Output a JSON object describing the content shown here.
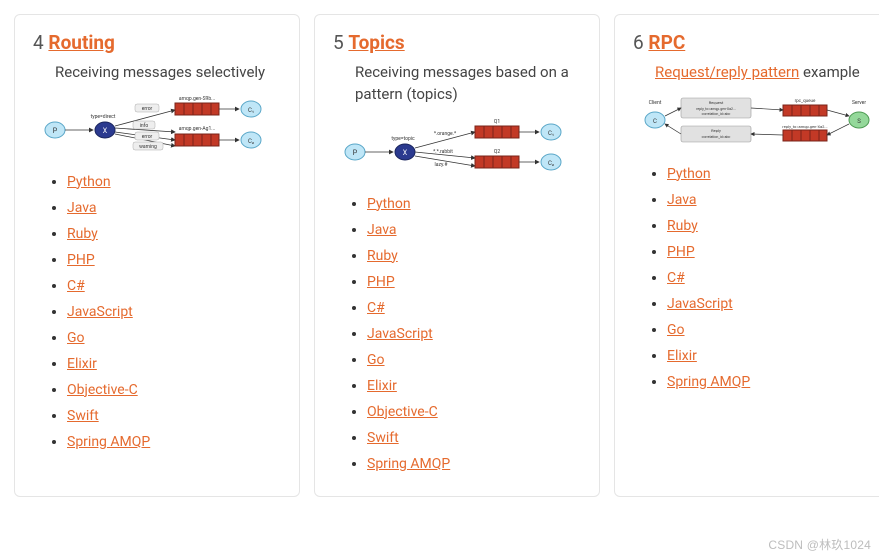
{
  "watermark": "CSDN @林玖1024",
  "cards": [
    {
      "number": "4",
      "title": "Routing",
      "desc_prefix": "",
      "desc_link": "",
      "desc_suffix": "Receiving messages selectively",
      "diagram_labels": {
        "ex_type": "type=direct",
        "b1": "error",
        "b2": "info",
        "b3": "error",
        "b4": "warning",
        "q1": "amqp.gen-S9b...",
        "q2": "amqp.gen-Ag1...",
        "c1": "C₁",
        "c2": "C₂"
      },
      "langs": [
        "Python",
        "Java",
        "Ruby",
        "PHP",
        "C#",
        "JavaScript",
        "Go",
        "Elixir",
        "Objective-C",
        "Swift",
        "Spring AMQP"
      ]
    },
    {
      "number": "5",
      "title": "Topics",
      "desc_prefix": "",
      "desc_link": "",
      "desc_suffix": "Receiving messages based on a pattern (topics)",
      "diagram_labels": {
        "ex_type": "type=topic",
        "b1": "*.orange.*",
        "b2": "*.*.rabbit",
        "b3": "lazy.#",
        "q1": "Q1",
        "q2": "Q2",
        "c1": "C₁",
        "c2": "C₂"
      },
      "langs": [
        "Python",
        "Java",
        "Ruby",
        "PHP",
        "C#",
        "JavaScript",
        "Go",
        "Elixir",
        "Objective-C",
        "Swift",
        "Spring AMQP"
      ]
    },
    {
      "number": "6",
      "title": "RPC",
      "desc_prefix": "",
      "desc_link": "Request/reply pattern",
      "desc_suffix": " example",
      "diagram_labels": {
        "client": "Client",
        "server": "Server",
        "req_box": "Request\nreply_to=amqp.gen-Xa2...\ncorrelation_id=abc",
        "rep_box": "Reply\ncorrelation_id=abc",
        "rpc_q": "rpc_queue",
        "reply_q": "reply_to=amqp.gen-Xa2..."
      },
      "langs": [
        "Python",
        "Java",
        "Ruby",
        "PHP",
        "C#",
        "JavaScript",
        "Go",
        "Elixir",
        "Spring AMQP"
      ]
    }
  ]
}
